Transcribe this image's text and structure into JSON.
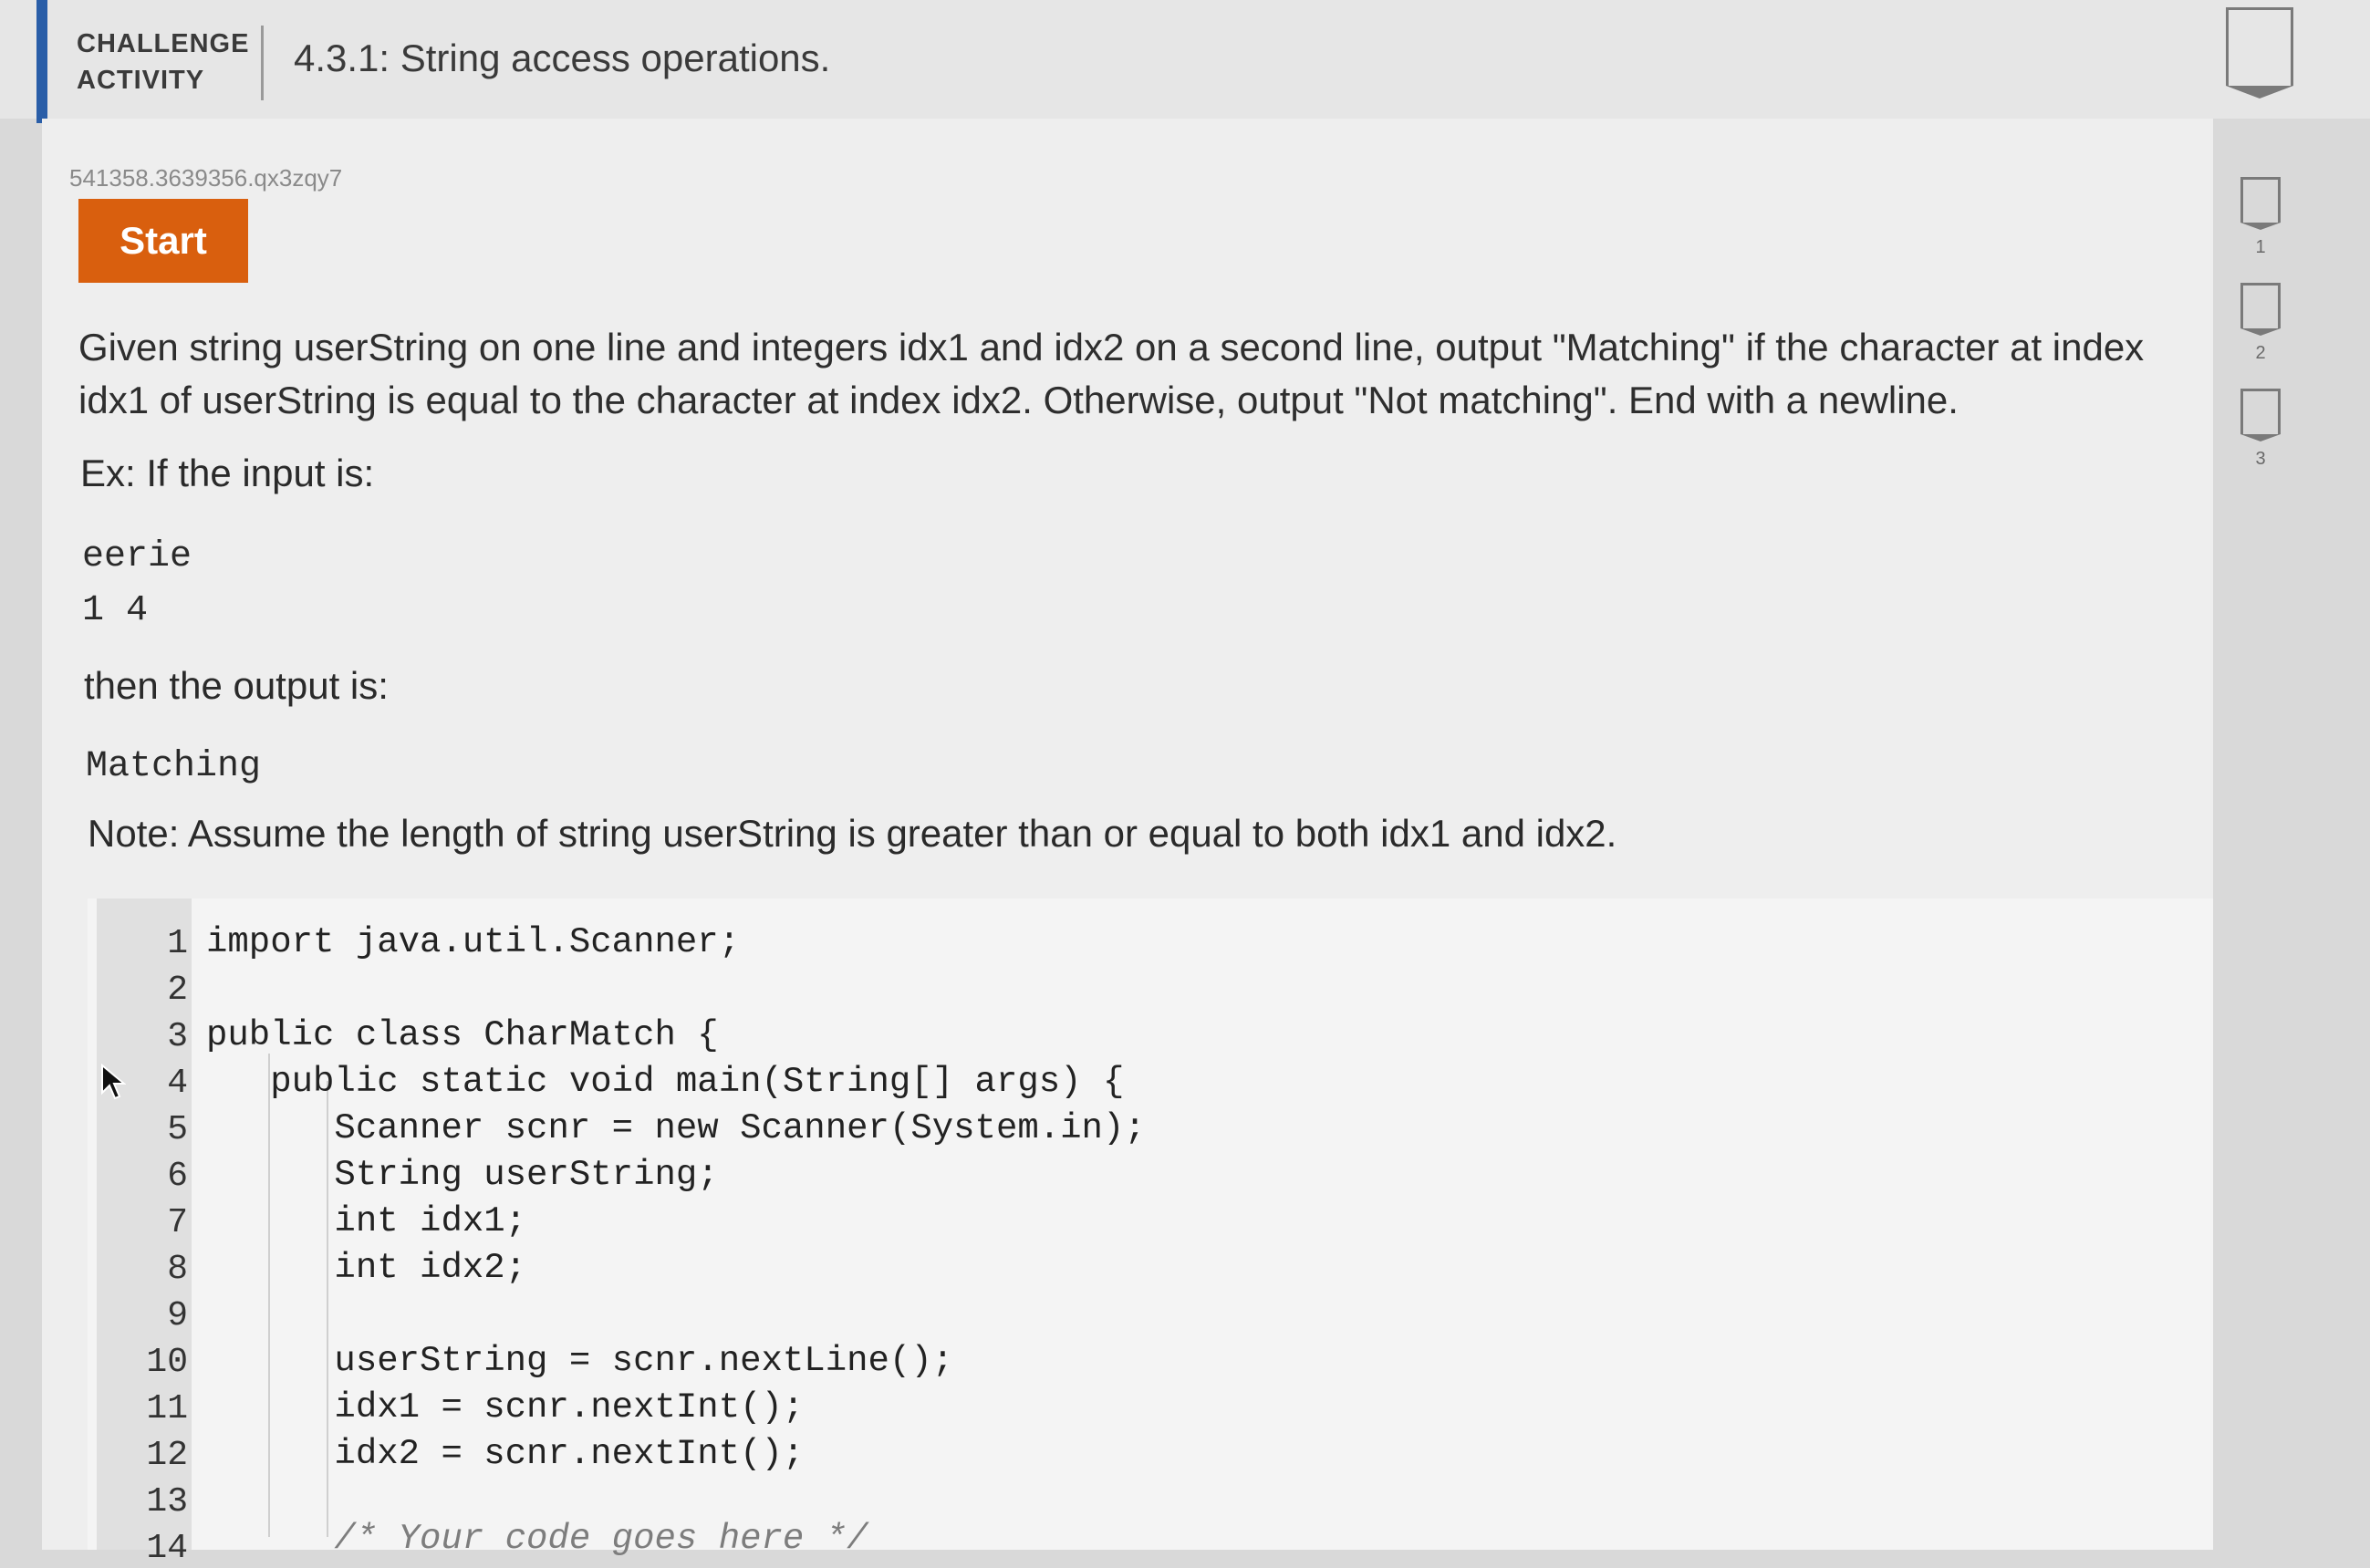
{
  "header": {
    "challenge_line1": "CHALLENGE",
    "challenge_line2": "ACTIVITY",
    "title": "4.3.1: String access operations."
  },
  "activity_id": "541358.3639356.qx3zqy7",
  "start_label": "Start",
  "levels": [
    "1",
    "2",
    "3"
  ],
  "prompt": "Given string userString on one line and integers idx1 and idx2 on a second line, output \"Matching\" if the character at index idx1 of userString is equal to the character at index idx2. Otherwise, output \"Not matching\". End with a newline.",
  "example": {
    "label": "Ex: If the input is:",
    "input_line1": "eerie",
    "input_line2": "1 4",
    "then_label": "then the output is:",
    "output": "Matching"
  },
  "note": "Note: Assume the length of string userString is greater than or equal to both idx1 and idx2.",
  "code": {
    "lines": [
      {
        "no": "1",
        "text": "import java.util.Scanner;"
      },
      {
        "no": "2",
        "text": ""
      },
      {
        "no": "3",
        "text": "public class CharMatch {"
      },
      {
        "no": "4",
        "text": "   public static void main(String[] args) {"
      },
      {
        "no": "5",
        "text": "      Scanner scnr = new Scanner(System.in);"
      },
      {
        "no": "6",
        "text": "      String userString;"
      },
      {
        "no": "7",
        "text": "      int idx1;"
      },
      {
        "no": "8",
        "text": "      int idx2;"
      },
      {
        "no": "9",
        "text": ""
      },
      {
        "no": "10",
        "text": "      userString = scnr.nextLine();"
      },
      {
        "no": "11",
        "text": "      idx1 = scnr.nextInt();"
      },
      {
        "no": "12",
        "text": "      idx2 = scnr.nextInt();"
      },
      {
        "no": "13",
        "text": ""
      },
      {
        "no": "14",
        "text": "      /* Your code goes here */"
      }
    ]
  },
  "colors": {
    "accent": "#2a5ea8",
    "start_button": "#d95f0e",
    "keyword": "#1f3f9e"
  }
}
